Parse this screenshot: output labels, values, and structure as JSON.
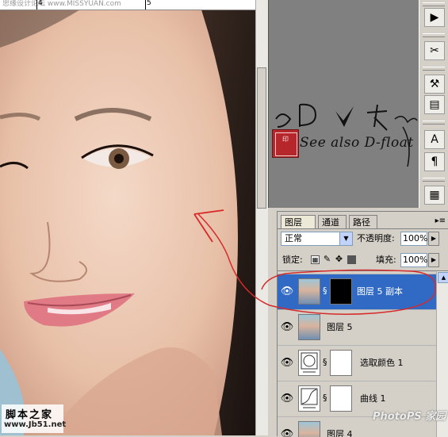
{
  "ruler": {
    "labels": [
      "4",
      "5"
    ],
    "watermark": "思缘设计论坛 www.MISSYUAN.com"
  },
  "canvas_watermark": {
    "line1": "脚本之家",
    "line2": "www.Jb51.net"
  },
  "corner_watermark": "PhotoPS 家园",
  "signature": {
    "text": "See also D-float",
    "seal_text": "印"
  },
  "tool_strip": {
    "icons": [
      "navigator-icon",
      "brush-icon",
      "tool-presets-icon",
      "layer-comps-icon",
      "character-icon",
      "paragraph-icon",
      "document-icon"
    ]
  },
  "layers_panel": {
    "tabs": [
      {
        "label": "图层",
        "active": true,
        "close": "×"
      },
      {
        "label": "通道",
        "active": false
      },
      {
        "label": "路径",
        "active": false
      }
    ],
    "menu_glyph": "▸≡",
    "blend_mode": "正常",
    "opacity_label": "不透明度:",
    "opacity_value": "100%",
    "lock_label": "锁定:",
    "fill_label": "填充:",
    "fill_value": "100%",
    "layers": [
      {
        "name": "图层 5 副本",
        "selected": true,
        "thumb": "photo",
        "has_mask": true
      },
      {
        "name": "图层 5",
        "selected": false,
        "thumb": "photo",
        "has_mask": false
      },
      {
        "name": "选取颜色 1",
        "selected": false,
        "thumb": "adjustment",
        "has_mask": true
      },
      {
        "name": "曲线 1",
        "selected": false,
        "thumb": "adjustment",
        "has_mask": true
      },
      {
        "name": "图层 4",
        "selected": false,
        "thumb": "photo",
        "has_mask": false
      }
    ]
  },
  "colors": {
    "selected_row": "#316ac5",
    "annotation": "#d62a2a",
    "panel_bg": "#d4d0c8",
    "workspace": "#808080"
  }
}
